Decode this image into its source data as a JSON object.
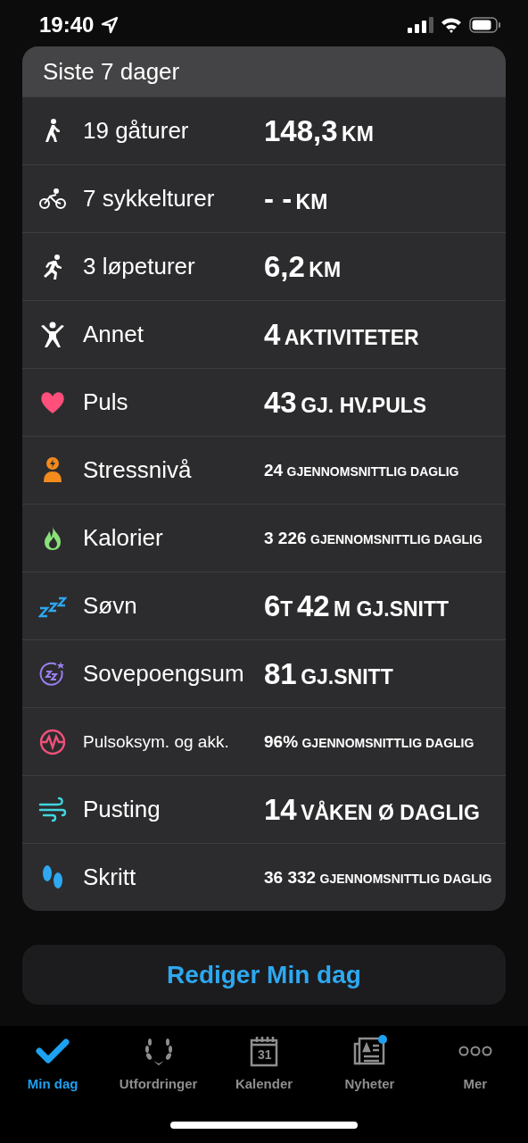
{
  "status_bar": {
    "time": "19:40"
  },
  "card": {
    "title": "Siste 7 dager",
    "rows": [
      {
        "label": "19 gåturer",
        "compact_label": false,
        "kind": "large",
        "value": [
          {
            "kind": "number",
            "text": "148,3"
          },
          {
            "kind": "unit",
            "text": "KM"
          }
        ]
      },
      {
        "label": "7 sykkelturer",
        "compact_label": false,
        "kind": "large",
        "value": [
          {
            "kind": "number",
            "text": "- -"
          },
          {
            "kind": "unit",
            "text": "KM"
          }
        ]
      },
      {
        "label": "3 løpeturer",
        "compact_label": false,
        "kind": "large",
        "value": [
          {
            "kind": "number",
            "text": "6,2"
          },
          {
            "kind": "unit",
            "text": "KM"
          }
        ]
      },
      {
        "label": "Annet",
        "compact_label": false,
        "kind": "large",
        "value": [
          {
            "kind": "number",
            "text": "4"
          },
          {
            "kind": "unit",
            "text": "AKTIVITETER"
          }
        ]
      },
      {
        "label": "Puls",
        "compact_label": false,
        "kind": "large",
        "value": [
          {
            "kind": "number",
            "text": "43"
          },
          {
            "kind": "unit",
            "text": "GJ. HV.PULS"
          }
        ]
      },
      {
        "label": "Stressnivå",
        "compact_label": false,
        "kind": "small",
        "value": [
          {
            "kind": "number",
            "text": "24"
          },
          {
            "kind": "unit",
            "text": "GJENNOMSNITTLIG DAGLIG"
          }
        ]
      },
      {
        "label": "Kalorier",
        "compact_label": false,
        "kind": "small",
        "value": [
          {
            "kind": "number",
            "text": "3 226"
          },
          {
            "kind": "unit",
            "text": "GJENNOMSNITTLIG DAGLIG"
          }
        ]
      },
      {
        "label": "Søvn",
        "compact_label": false,
        "kind": "large",
        "value": [
          {
            "kind": "number",
            "text": "6"
          },
          {
            "kind": "unit",
            "text": "T"
          },
          {
            "kind": "number",
            "text": "42"
          },
          {
            "kind": "unit",
            "text": "M GJ.SNITT"
          }
        ]
      },
      {
        "label": "Sovepoengsum",
        "compact_label": false,
        "kind": "large",
        "value": [
          {
            "kind": "number",
            "text": "81"
          },
          {
            "kind": "unit",
            "text": "GJ.SNITT"
          }
        ]
      },
      {
        "label": "Pulsoksym. og akk.",
        "compact_label": true,
        "kind": "small",
        "value": [
          {
            "kind": "number",
            "text": "96%"
          },
          {
            "kind": "unit",
            "text": "GJENNOMSNITTLIG DAGLIG"
          }
        ]
      },
      {
        "label": "Pusting",
        "compact_label": false,
        "kind": "large",
        "value": [
          {
            "kind": "number",
            "text": "14"
          },
          {
            "kind": "unit",
            "text": "VÅKEN Ø DAGLIG"
          }
        ]
      },
      {
        "label": "Skritt",
        "compact_label": false,
        "kind": "small",
        "value": [
          {
            "kind": "number",
            "text": "36 332"
          },
          {
            "kind": "unit",
            "text": "GJENNOMSNITTLIG DAGLIG"
          }
        ]
      }
    ]
  },
  "edit_button": {
    "label": "Rediger Min dag"
  },
  "tab_bar": [
    {
      "label": "Min dag",
      "selected": true,
      "badge": false
    },
    {
      "label": "Utfordringer",
      "selected": false,
      "badge": false
    },
    {
      "label": "Kalender",
      "selected": false,
      "badge": false,
      "icon_text": "31"
    },
    {
      "label": "Nyheter",
      "selected": false,
      "badge": true
    },
    {
      "label": "Mer",
      "selected": false,
      "badge": false
    }
  ]
}
